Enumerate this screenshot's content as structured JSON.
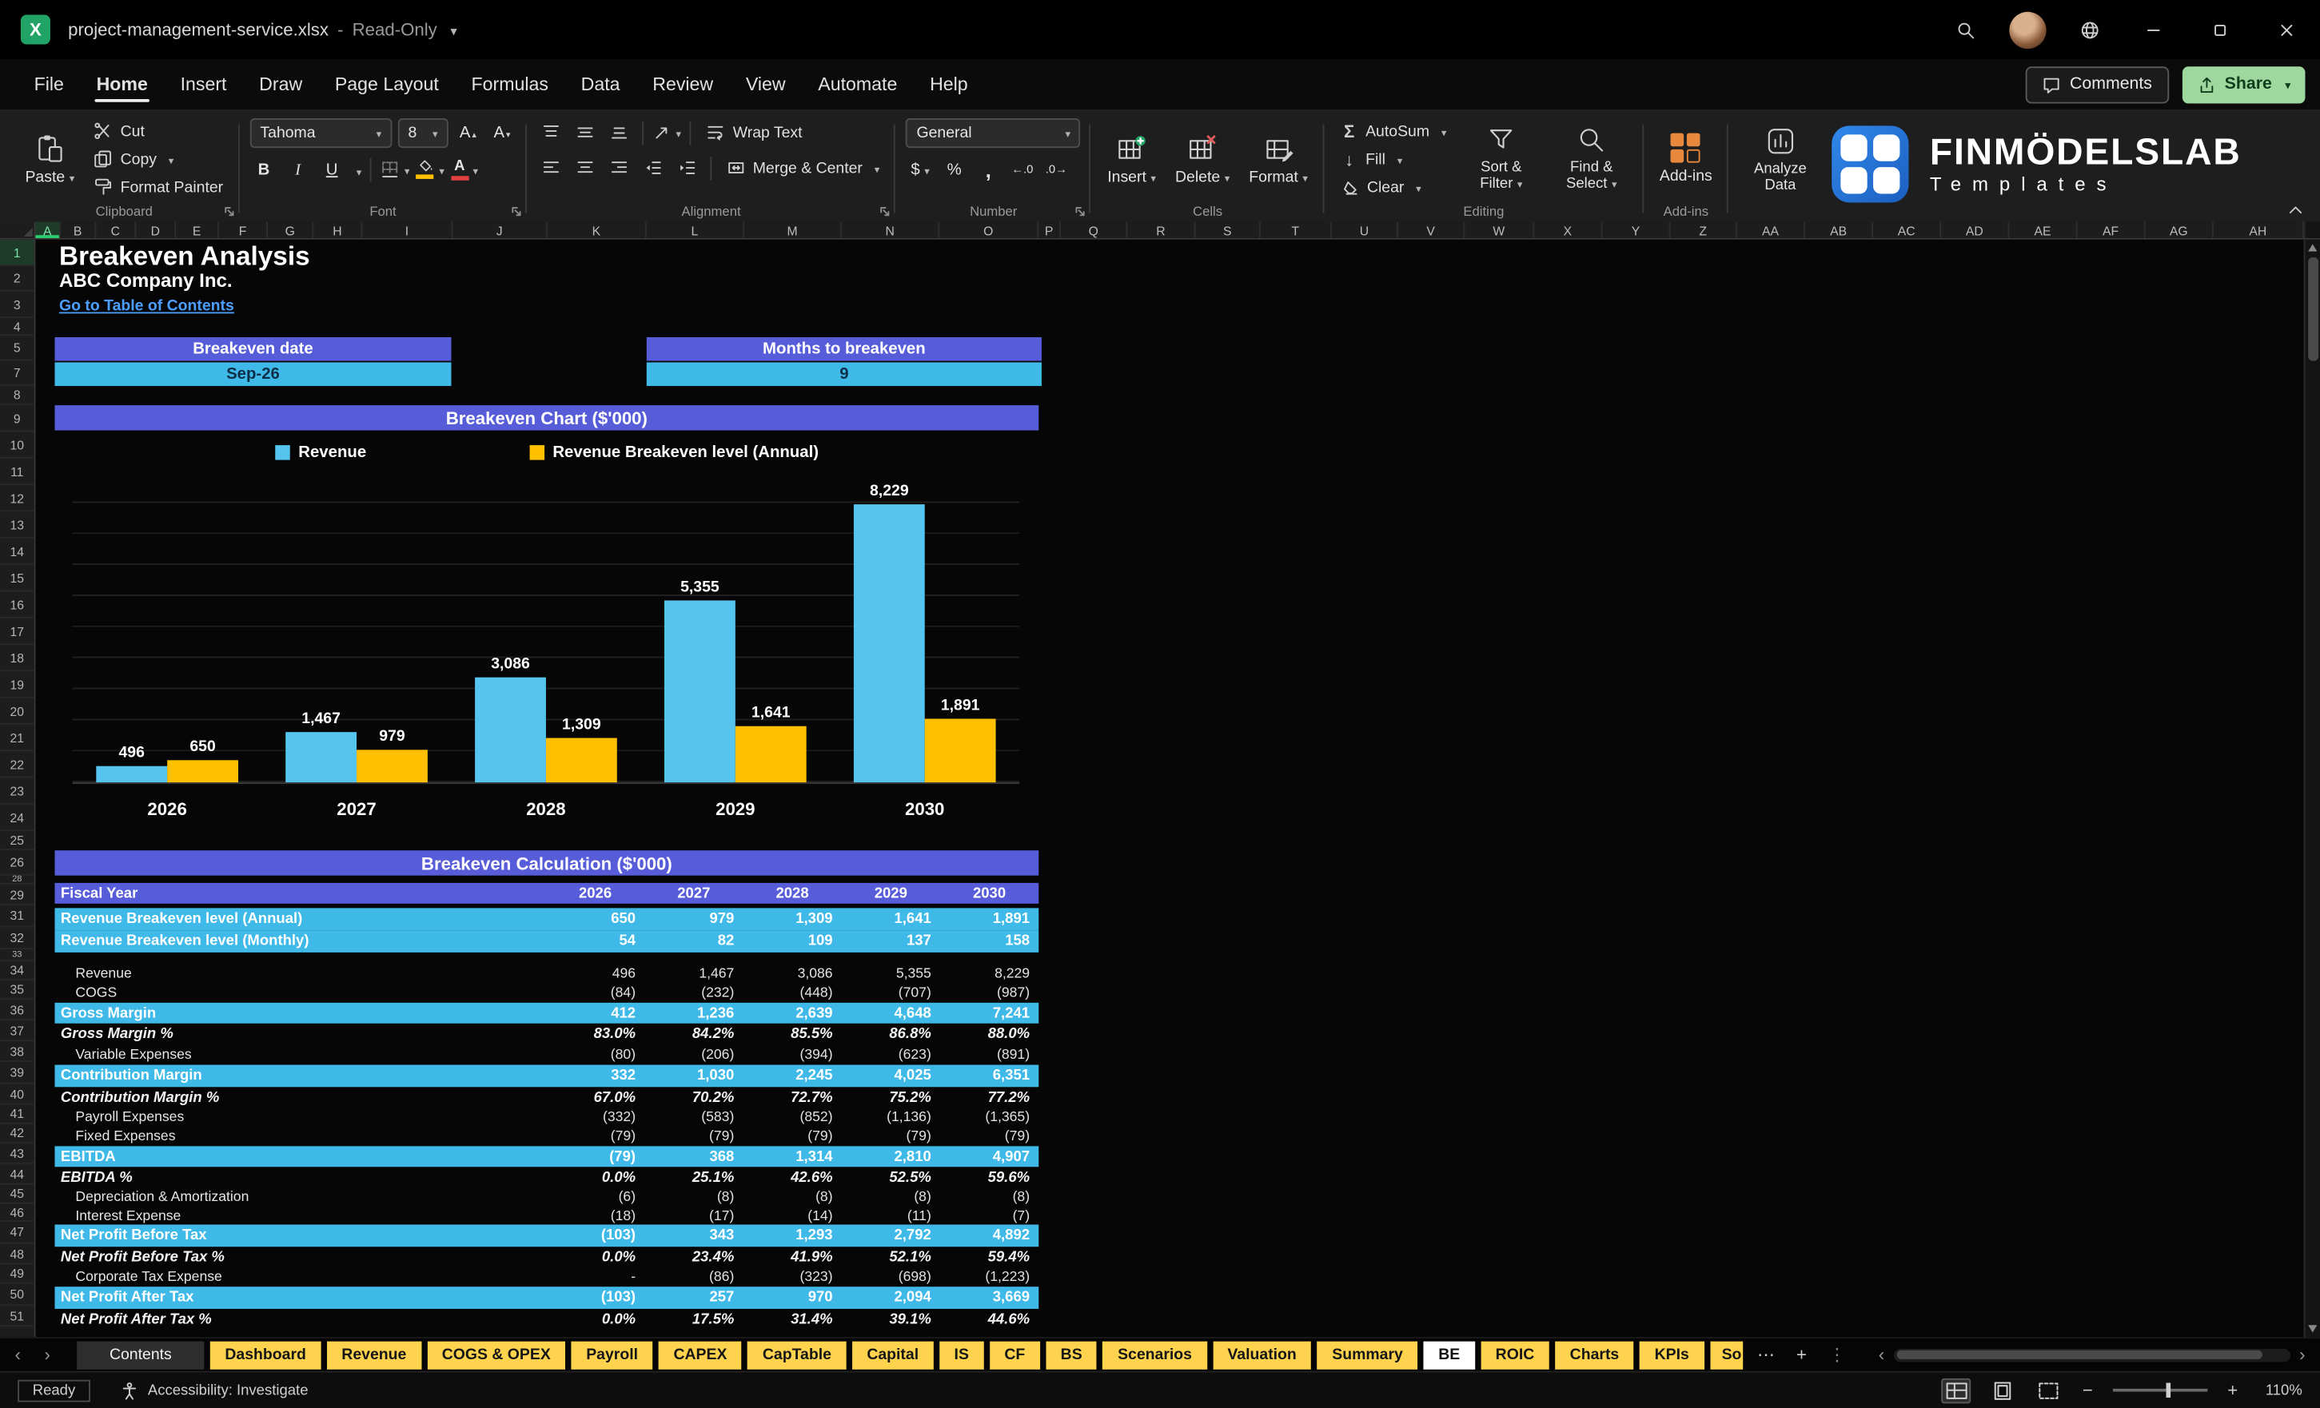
{
  "colors": {
    "accent_purple": "#575CD8",
    "accent_blue": "#3FB9E8",
    "chart_blue": "#55C4EE",
    "chart_yellow": "#FFC000",
    "tab_yellow": "#FFD34D",
    "link_blue": "#4C9FFF",
    "brand_blue": "#2D7DE1",
    "share_green": "#9FD89F",
    "addins_orange": "#E8883C",
    "excel_green": "#21A366"
  },
  "titlebar": {
    "app_glyph": "X",
    "filename": "project-management-service.xlsx",
    "separator": "-",
    "mode": "Read-Only"
  },
  "menu": {
    "items": [
      "File",
      "Home",
      "Insert",
      "Draw",
      "Page Layout",
      "Formulas",
      "Data",
      "Review",
      "View",
      "Automate",
      "Help"
    ],
    "active": "Home",
    "comments": "Comments",
    "share": "Share"
  },
  "ribbon": {
    "clipboard": {
      "label": "Clipboard",
      "paste": "Paste",
      "cut": "Cut",
      "copy": "Copy",
      "format_painter": "Format Painter"
    },
    "font": {
      "label": "Font",
      "family": "Tahoma",
      "size": "8",
      "bold": "B",
      "italic": "I",
      "underline": "U",
      "grow_glyph": "A",
      "shrink_glyph": "A",
      "color_glyph": "A"
    },
    "alignment": {
      "label": "Alignment",
      "wrap_text": "Wrap Text",
      "merge_center": "Merge & Center"
    },
    "number": {
      "label": "Number",
      "format": "General",
      "currency": "$",
      "percent": "%",
      "comma": ",",
      "inc_decimal": "←.0",
      "dec_decimal": ".0→"
    },
    "cells": {
      "label": "Cells",
      "insert": "Insert",
      "delete": "Delete",
      "format": "Format"
    },
    "editing": {
      "label": "Editing",
      "autosum_glyph": "Σ",
      "autosum": "AutoSum",
      "fill_glyph": "↓",
      "fill": "Fill",
      "clear": "Clear",
      "sort_filter": "Sort & Filter",
      "find_select": "Find & Select"
    },
    "addins": {
      "label": "Add-ins",
      "addins": "Add-ins",
      "analyze": "Analyze Data"
    },
    "brand": {
      "name": "FINMÖDELSLAB",
      "sub": "Templates"
    }
  },
  "grid": {
    "columns": [
      "A",
      "B",
      "C",
      "D",
      "E",
      "F",
      "G",
      "H",
      "I",
      "J",
      "K",
      "L",
      "M",
      "N",
      "O",
      "P",
      "Q",
      "R",
      "S",
      "T",
      "U",
      "V",
      "W",
      "X",
      "Y",
      "Z",
      "AA",
      "AB",
      "AC",
      "AD",
      "AE",
      "AF",
      "AG",
      "AH"
    ],
    "rows": [
      "1",
      "2",
      "3",
      "4",
      "5",
      "7",
      "8",
      "9",
      "10",
      "11",
      "12",
      "13",
      "14",
      "15",
      "16",
      "17",
      "18",
      "19",
      "20",
      "21",
      "22",
      "23",
      "24",
      "25",
      "26",
      "28",
      "29",
      "31",
      "32",
      "33",
      "34",
      "35",
      "36",
      "37",
      "38",
      "39",
      "40",
      "41",
      "42",
      "43",
      "44",
      "45",
      "46",
      "47",
      "48",
      "49",
      "50",
      "51"
    ]
  },
  "sheet": {
    "title": "Breakeven Analysis",
    "company": "ABC Company Inc.",
    "toc": "Go to Table of Contents",
    "breakeven_date_label": "Breakeven date",
    "breakeven_date_value": "Sep-26",
    "months_label": "Months to breakeven",
    "months_value": "9",
    "chart_header": "Breakeven Chart ($'000)",
    "calc_header": "Breakeven Calculation ($'000)"
  },
  "chart_data": {
    "type": "bar",
    "title": "Breakeven Chart ($'000)",
    "categories": [
      "2026",
      "2027",
      "2028",
      "2029",
      "2030"
    ],
    "series": [
      {
        "name": "Revenue",
        "color": "#55C4EE",
        "values": [
          496,
          1467,
          3086,
          5355,
          8229
        ],
        "labels": [
          "496",
          "1,467",
          "3,086",
          "5,355",
          "8,229"
        ]
      },
      {
        "name": "Revenue Breakeven level (Annual)",
        "color": "#FFC000",
        "values": [
          650,
          979,
          1309,
          1641,
          1891
        ],
        "labels": [
          "650",
          "979",
          "1,309",
          "1,641",
          "1,891"
        ]
      }
    ],
    "xlabel": "",
    "ylabel": "",
    "ylim": [
      0,
      9000
    ],
    "grid": true,
    "legend_position": "top"
  },
  "table": {
    "header": {
      "label": "Fiscal Year",
      "years": [
        "2026",
        "2027",
        "2028",
        "2029",
        "2030"
      ]
    },
    "rows": [
      {
        "label": "Revenue Breakeven level (Annual)",
        "values": [
          "650",
          "979",
          "1,309",
          "1,641",
          "1,891"
        ],
        "style": "highlight"
      },
      {
        "label": "Revenue Breakeven level (Monthly)",
        "values": [
          "54",
          "82",
          "109",
          "137",
          "158"
        ],
        "style": "highlight"
      },
      {
        "label": "Revenue",
        "values": [
          "496",
          "1,467",
          "3,086",
          "5,355",
          "8,229"
        ],
        "style": "plain"
      },
      {
        "label": "COGS",
        "values": [
          "(84)",
          "(232)",
          "(448)",
          "(707)",
          "(987)"
        ],
        "style": "plain"
      },
      {
        "label": "Gross Margin",
        "values": [
          "412",
          "1,236",
          "2,639",
          "4,648",
          "7,241"
        ],
        "style": "highlight"
      },
      {
        "label": "Gross Margin %",
        "values": [
          "83.0%",
          "84.2%",
          "85.5%",
          "86.8%",
          "88.0%"
        ],
        "style": "pct"
      },
      {
        "label": "Variable Expenses",
        "values": [
          "(80)",
          "(206)",
          "(394)",
          "(623)",
          "(891)"
        ],
        "style": "plain"
      },
      {
        "label": "Contribution Margin",
        "values": [
          "332",
          "1,030",
          "2,245",
          "4,025",
          "6,351"
        ],
        "style": "highlight"
      },
      {
        "label": "Contribution Margin %",
        "values": [
          "67.0%",
          "70.2%",
          "72.7%",
          "75.2%",
          "77.2%"
        ],
        "style": "pct"
      },
      {
        "label": "Payroll Expenses",
        "values": [
          "(332)",
          "(583)",
          "(852)",
          "(1,136)",
          "(1,365)"
        ],
        "style": "plain"
      },
      {
        "label": "Fixed Expenses",
        "values": [
          "(79)",
          "(79)",
          "(79)",
          "(79)",
          "(79)"
        ],
        "style": "plain"
      },
      {
        "label": "EBITDA",
        "values": [
          "(79)",
          "368",
          "1,314",
          "2,810",
          "4,907"
        ],
        "style": "highlight"
      },
      {
        "label": "EBITDA %",
        "values": [
          "0.0%",
          "25.1%",
          "42.6%",
          "52.5%",
          "59.6%"
        ],
        "style": "pct"
      },
      {
        "label": "Depreciation & Amortization",
        "values": [
          "(6)",
          "(8)",
          "(8)",
          "(8)",
          "(8)"
        ],
        "style": "plain"
      },
      {
        "label": "Interest Expense",
        "values": [
          "(18)",
          "(17)",
          "(14)",
          "(11)",
          "(7)"
        ],
        "style": "plain"
      },
      {
        "label": "Net Profit Before Tax",
        "values": [
          "(103)",
          "343",
          "1,293",
          "2,792",
          "4,892"
        ],
        "style": "highlight"
      },
      {
        "label": "Net Profit Before Tax %",
        "values": [
          "0.0%",
          "23.4%",
          "41.9%",
          "52.1%",
          "59.4%"
        ],
        "style": "pct"
      },
      {
        "label": "Corporate Tax Expense",
        "values": [
          "-",
          "(86)",
          "(323)",
          "(698)",
          "(1,223)"
        ],
        "style": "plain"
      },
      {
        "label": "Net Profit After Tax",
        "values": [
          "(103)",
          "257",
          "970",
          "2,094",
          "3,669"
        ],
        "style": "highlight"
      },
      {
        "label": "Net Profit After Tax %",
        "values": [
          "0.0%",
          "17.5%",
          "31.4%",
          "39.1%",
          "44.6%"
        ],
        "style": "pct"
      }
    ]
  },
  "tabs": {
    "items": [
      {
        "label": "Contents",
        "style": "dark"
      },
      {
        "label": "Dashboard",
        "style": "yellow"
      },
      {
        "label": "Revenue",
        "style": "yellow"
      },
      {
        "label": "COGS & OPEX",
        "style": "yellow"
      },
      {
        "label": "Payroll",
        "style": "yellow"
      },
      {
        "label": "CAPEX",
        "style": "yellow"
      },
      {
        "label": "CapTable",
        "style": "yellow"
      },
      {
        "label": "Capital",
        "style": "yellow"
      },
      {
        "label": "IS",
        "style": "yellow"
      },
      {
        "label": "CF",
        "style": "yellow"
      },
      {
        "label": "BS",
        "style": "yellow"
      },
      {
        "label": "Scenarios",
        "style": "yellow"
      },
      {
        "label": "Valuation",
        "style": "yellow"
      },
      {
        "label": "Summary",
        "style": "yellow"
      },
      {
        "label": "BE",
        "style": "active"
      },
      {
        "label": "ROIC",
        "style": "yellow"
      },
      {
        "label": "Charts",
        "style": "yellow"
      },
      {
        "label": "KPIs",
        "style": "yellow"
      },
      {
        "label": "So",
        "style": "yellow clip"
      }
    ],
    "overflow": "⋯",
    "add": "+",
    "more": "⋮"
  },
  "statusbar": {
    "ready": "Ready",
    "accessibility": "Accessibility: Investigate",
    "zoom_out": "−",
    "zoom_in": "+",
    "zoom": "110%"
  }
}
